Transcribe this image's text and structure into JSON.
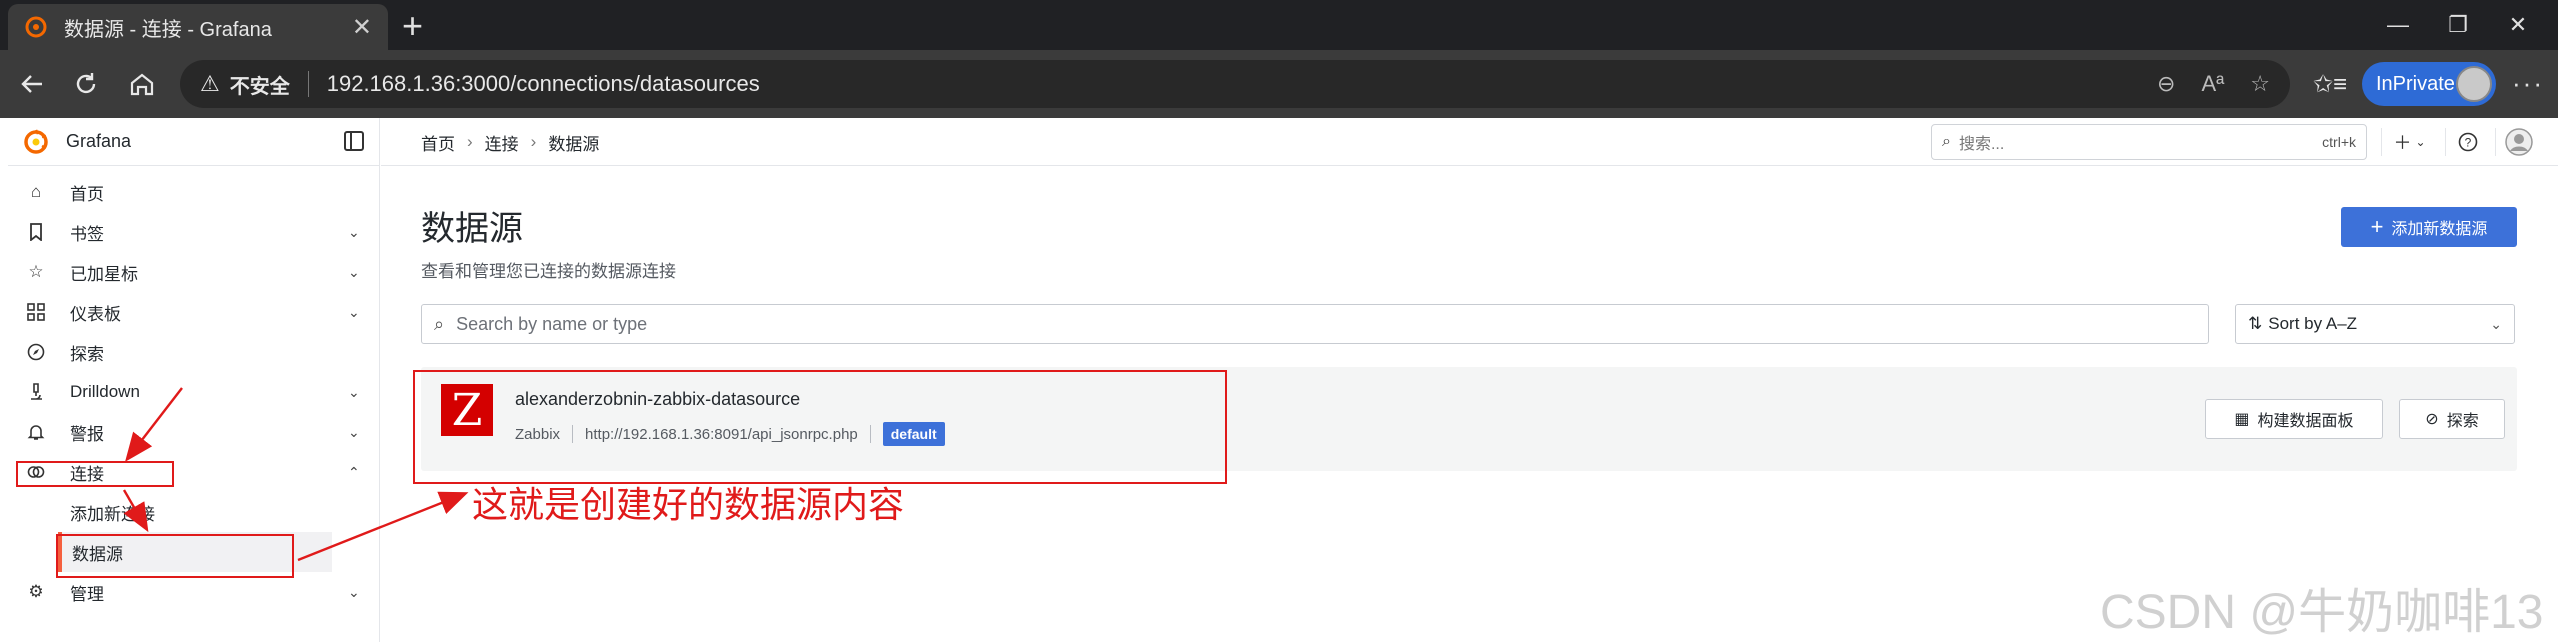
{
  "browser": {
    "tab_title": "数据源 - 连接 - Grafana",
    "security_label": "不安全",
    "url": "192.168.1.36:3000/connections/datasources",
    "profile_label": "InPrivate"
  },
  "app": {
    "brand": "Grafana",
    "search_placeholder": "搜索...",
    "search_shortcut": "ctrl+k"
  },
  "breadcrumb": [
    "首页",
    "连接",
    "数据源"
  ],
  "sidebar": {
    "items": [
      {
        "label": "首页",
        "icon": "home-icon"
      },
      {
        "label": "书签",
        "icon": "bookmark-icon"
      },
      {
        "label": "已加星标",
        "icon": "star-icon"
      },
      {
        "label": "仪表板",
        "icon": "dashboard-grid-icon"
      },
      {
        "label": "探索",
        "icon": "compass-icon"
      },
      {
        "label": "Drilldown",
        "icon": "microscope-icon"
      },
      {
        "label": "警报",
        "icon": "bell-icon"
      },
      {
        "label": "连接",
        "icon": "link-icon"
      },
      {
        "label": "添加新连接",
        "icon": ""
      },
      {
        "label": "数据源",
        "icon": ""
      },
      {
        "label": "管理",
        "icon": "gear-icon"
      }
    ]
  },
  "page": {
    "title": "数据源",
    "subtitle": "查看和管理您已连接的数据源连接",
    "add_button": "添加新数据源",
    "search_placeholder": "Search by name or type",
    "sort_label": "Sort by A–Z"
  },
  "datasource": {
    "logo_letter": "Z",
    "name": "alexanderzobnin-zabbix-datasource",
    "type": "Zabbix",
    "url": "http://192.168.1.36:8091/api_jsonrpc.php",
    "badge": "default",
    "build_button": "构建数据面板",
    "explore_button": "探索"
  },
  "annotation": {
    "text": "这就是创建好的数据源内容",
    "color": "#e01a1a"
  },
  "watermark": "CSDN @牛奶咖啡13",
  "colors": {
    "accent": "#3d71d9",
    "active_bar": "#f55f3e",
    "zabbix_red": "#d40000"
  }
}
